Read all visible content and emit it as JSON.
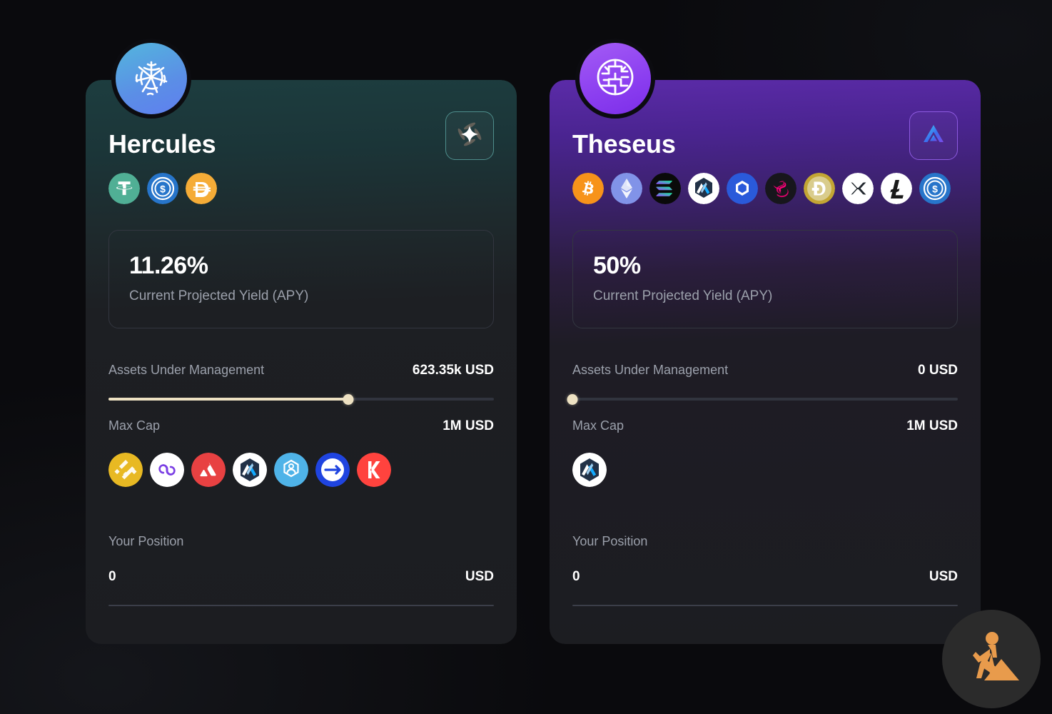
{
  "background_color": "#0a0a0d",
  "cards": [
    {
      "id": "hercules",
      "name": "Hercules",
      "accent_color": "#1d3d3f",
      "avatar_icon": "web-icon",
      "protocol_badge_icon": "diamond-star-icon",
      "apy": {
        "value": "11.26%",
        "label": "Current Projected Yield (APY)"
      },
      "aum": {
        "label": "Assets Under Management",
        "value": "623.35k USD",
        "progress_percent": 62.3
      },
      "max_cap": {
        "label": "Max Cap",
        "value": "1M USD"
      },
      "position": {
        "label": "Your Position",
        "amount": "0",
        "currency": "USD"
      },
      "tokens": [
        {
          "symbol": "USDT",
          "icon": "usdt-icon"
        },
        {
          "symbol": "USDC",
          "icon": "usdc-icon"
        },
        {
          "symbol": "DAI",
          "icon": "dai-icon"
        }
      ],
      "chains": [
        {
          "symbol": "BNB",
          "icon": "bnb-chain-icon"
        },
        {
          "symbol": "POLYGON",
          "icon": "polygon-chain-icon"
        },
        {
          "symbol": "AVAX",
          "icon": "avalanche-chain-icon"
        },
        {
          "symbol": "ARB",
          "icon": "arbitrum-chain-icon"
        },
        {
          "symbol": "BASE",
          "icon": "base-chain-icon"
        },
        {
          "symbol": "OPTIMISM",
          "icon": "optimism-chain-icon"
        },
        {
          "symbol": "KAVA",
          "icon": "kava-chain-icon"
        }
      ]
    },
    {
      "id": "theseus",
      "name": "Theseus",
      "accent_color": "#5b2ba8",
      "avatar_icon": "labyrinth-icon",
      "protocol_badge_icon": "aerodrome-triangle-icon",
      "apy": {
        "value": "50%",
        "label": "Current Projected Yield (APY)"
      },
      "aum": {
        "label": "Assets Under Management",
        "value": "0 USD",
        "progress_percent": 0
      },
      "max_cap": {
        "label": "Max Cap",
        "value": "1M USD"
      },
      "position": {
        "label": "Your Position",
        "amount": "0",
        "currency": "USD"
      },
      "tokens": [
        {
          "symbol": "BTC",
          "icon": "bitcoin-icon"
        },
        {
          "symbol": "ETH",
          "icon": "ethereum-icon"
        },
        {
          "symbol": "SOL",
          "icon": "solana-icon"
        },
        {
          "symbol": "ARB",
          "icon": "arbitrum-icon"
        },
        {
          "symbol": "LINK",
          "icon": "chainlink-icon"
        },
        {
          "symbol": "UNI",
          "icon": "uniswap-icon"
        },
        {
          "symbol": "DOGE",
          "icon": "dogecoin-icon"
        },
        {
          "symbol": "XRP",
          "icon": "ripple-icon"
        },
        {
          "symbol": "LTC",
          "icon": "litecoin-icon"
        },
        {
          "symbol": "USDC",
          "icon": "usdc-icon"
        }
      ],
      "chains": [
        {
          "symbol": "ARB",
          "icon": "arbitrum-chain-icon"
        }
      ]
    }
  ],
  "floating_badge": {
    "icon": "construction-worker-icon",
    "color": "#e89b4c"
  }
}
